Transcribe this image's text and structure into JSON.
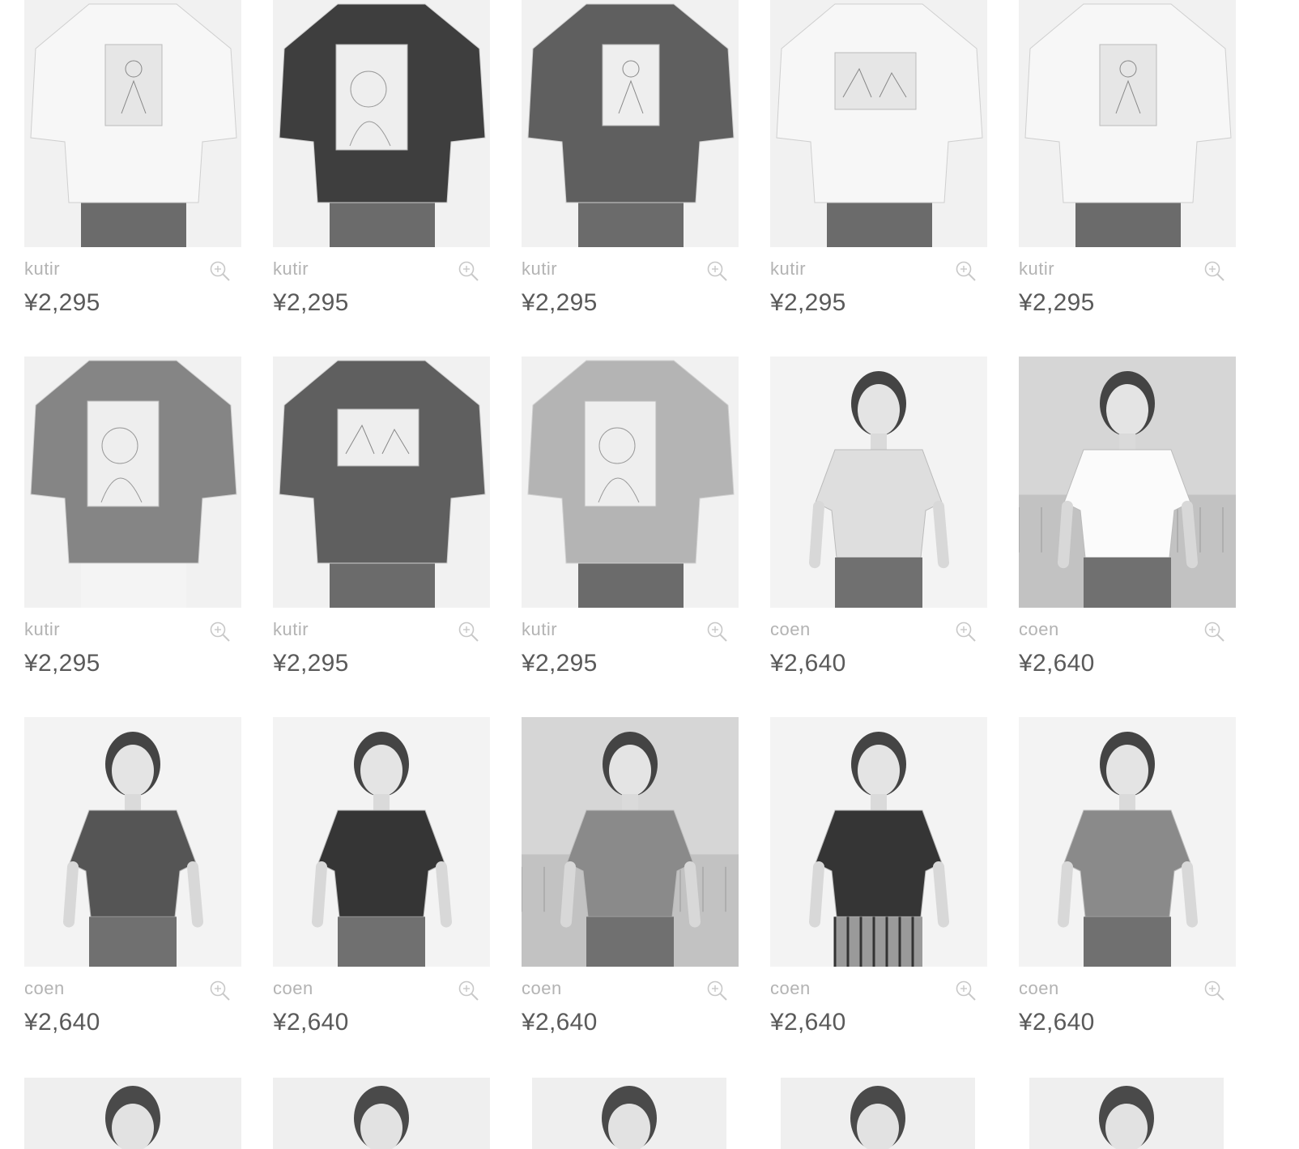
{
  "products": [
    {
      "brand": "kutir",
      "price": "¥2,295",
      "image": "tshirt-white-back-illustration"
    },
    {
      "brand": "kutir",
      "price": "¥2,295",
      "image": "tshirt-black-back-craze-print"
    },
    {
      "brand": "kutir",
      "price": "¥2,295",
      "image": "tshirt-dark-back-illustration"
    },
    {
      "brand": "kutir",
      "price": "¥2,295",
      "image": "tshirt-white-back-park-print"
    },
    {
      "brand": "kutir",
      "price": "¥2,295",
      "image": "tshirt-white-back-illustration"
    },
    {
      "brand": "kutir",
      "price": "¥2,295",
      "image": "tshirt-grey-back-craze-print"
    },
    {
      "brand": "kutir",
      "price": "¥2,295",
      "image": "tshirt-dark-back-park-print"
    },
    {
      "brand": "kutir",
      "price": "¥2,295",
      "image": "tshirt-light-back-craze-print"
    },
    {
      "brand": "coen",
      "price": "¥2,640",
      "image": "woman-light-top-profile"
    },
    {
      "brand": "coen",
      "price": "¥2,640",
      "image": "woman-white-top-outdoor"
    },
    {
      "brand": "coen",
      "price": "¥2,640",
      "image": "woman-dark-top-smiling"
    },
    {
      "brand": "coen",
      "price": "¥2,640",
      "image": "woman-black-top"
    },
    {
      "brand": "coen",
      "price": "¥2,640",
      "image": "woman-grey-top-outdoor"
    },
    {
      "brand": "coen",
      "price": "¥2,640",
      "image": "woman-black-top-check-skirt"
    },
    {
      "brand": "coen",
      "price": "¥2,640",
      "image": "woman-grey-top"
    }
  ],
  "partial_row_images": [
    "woman-smiling",
    "woman-portrait",
    "woman-hair-bun",
    "woman-portrait",
    "woman-portrait"
  ],
  "icons": {
    "zoom": "zoom-in-icon"
  }
}
